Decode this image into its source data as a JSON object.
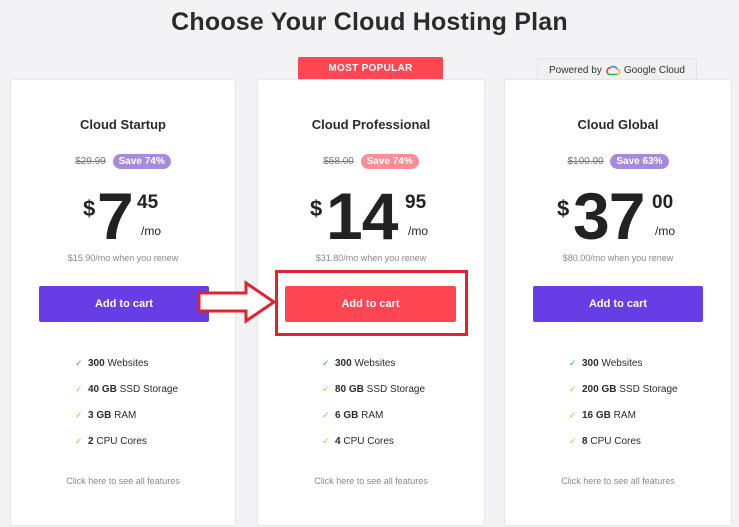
{
  "page": {
    "title": "Choose Your Cloud Hosting Plan"
  },
  "badges": {
    "most_popular": "MOST POPULAR",
    "powered_by": "Powered by",
    "google_cloud": "Google Cloud"
  },
  "plans": [
    {
      "name": "Cloud Startup",
      "old_price": "$29.99",
      "save": "Save 74%",
      "currency": "$",
      "price_int": "7",
      "price_cents": "45",
      "per": "/mo",
      "renew": "$15.90/mo when you renew",
      "cta": "Add to cart",
      "features": [
        {
          "bold": "300",
          "text": " Websites",
          "icon": "check-green"
        },
        {
          "bold": "40 GB",
          "text": " SSD Storage",
          "icon": "check-orange"
        },
        {
          "bold": "3 GB",
          "text": " RAM",
          "icon": "check-orange"
        },
        {
          "bold": "2",
          "text": " CPU Cores",
          "icon": "check-orange"
        }
      ],
      "see_all": "Click here to see all features"
    },
    {
      "name": "Cloud Professional",
      "old_price": "$58.00",
      "save": "Save 74%",
      "currency": "$",
      "price_int": "14",
      "price_cents": "95",
      "per": "/mo",
      "renew": "$31.80/mo when you renew",
      "cta": "Add to cart",
      "features": [
        {
          "bold": "300",
          "text": " Websites",
          "icon": "check-green"
        },
        {
          "bold": "80 GB",
          "text": " SSD Storage",
          "icon": "check-orange"
        },
        {
          "bold": "6 GB",
          "text": " RAM",
          "icon": "check-orange"
        },
        {
          "bold": "4",
          "text": " CPU Cores",
          "icon": "check-orange"
        }
      ],
      "see_all": "Click here to see all features"
    },
    {
      "name": "Cloud Global",
      "old_price": "$100.00",
      "save": "Save 63%",
      "currency": "$",
      "price_int": "37",
      "price_cents": "00",
      "per": "/mo",
      "renew": "$80.00/mo when you renew",
      "cta": "Add to cart",
      "features": [
        {
          "bold": "300",
          "text": " Websites",
          "icon": "check-green"
        },
        {
          "bold": "200 GB",
          "text": " SSD Storage",
          "icon": "check-orange"
        },
        {
          "bold": "16 GB",
          "text": " RAM",
          "icon": "check-orange"
        },
        {
          "bold": "8",
          "text": " CPU Cores",
          "icon": "check-orange"
        }
      ],
      "see_all": "Click here to see all features"
    }
  ],
  "colors": {
    "purple_button": "#673de6",
    "red_button": "#ff4652",
    "annotation_red": "#e0232d"
  }
}
